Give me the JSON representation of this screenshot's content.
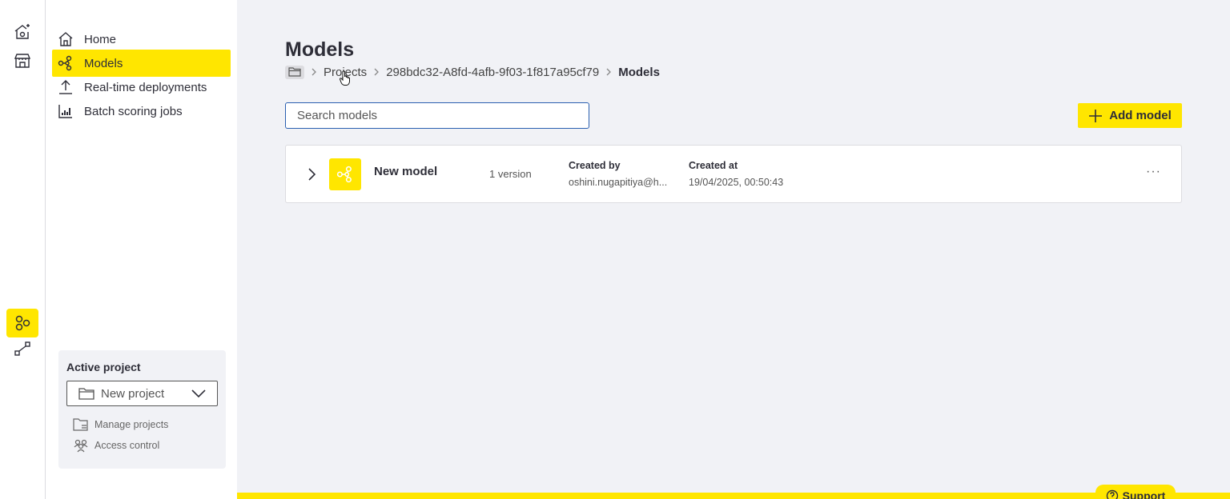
{
  "rail": {
    "items": [
      {
        "icon": "home-sparkle-icon"
      },
      {
        "icon": "store-icon"
      },
      {
        "icon": "models-app-icon",
        "active": true
      },
      {
        "icon": "pipeline-icon"
      }
    ]
  },
  "nav": {
    "items": [
      {
        "label": "Home",
        "icon": "home-icon"
      },
      {
        "label": "Models",
        "icon": "models-icon",
        "active": true
      },
      {
        "label": "Real-time deployments",
        "icon": "upload-icon"
      },
      {
        "label": "Batch scoring jobs",
        "icon": "batch-chart-icon"
      }
    ]
  },
  "active_project": {
    "title": "Active project",
    "selected": "New project",
    "links": [
      "Manage projects",
      "Access control"
    ]
  },
  "page": {
    "title": "Models",
    "breadcrumb": {
      "items": [
        "Projects",
        "298bdc32-A8fd-4afb-9f03-1f817a95cf79"
      ],
      "current": "Models"
    },
    "search_placeholder": "Search models",
    "add_button": "Add model"
  },
  "models": [
    {
      "name": "New model",
      "version": "1 version",
      "created_by_label": "Created by",
      "created_by": "oshini.nugapitiya@h...",
      "created_at_label": "Created at",
      "created_at": "19/04/2025, 00:50:43"
    }
  ],
  "support": {
    "label": "Support"
  },
  "colors": {
    "accent": "#ffe600",
    "focus": "#2a5fb0",
    "background": "#f1f2f6"
  }
}
